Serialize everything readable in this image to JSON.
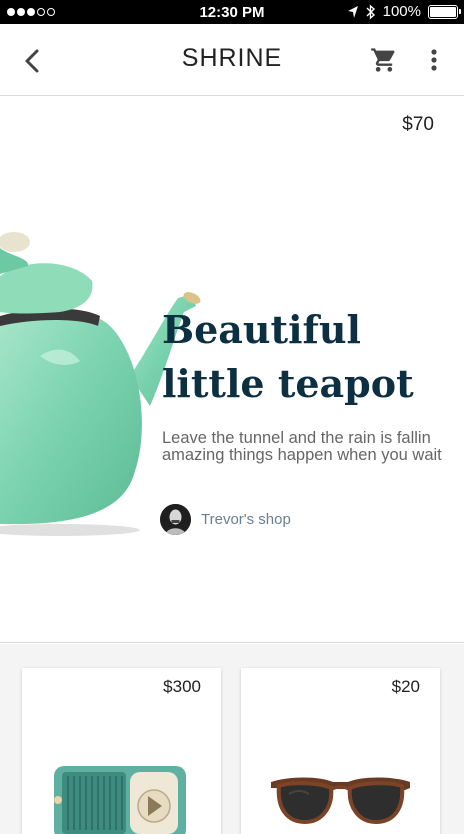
{
  "status_bar": {
    "time": "12:30 PM",
    "battery": "100%"
  },
  "app_bar": {
    "title": "SHRINE"
  },
  "featured": {
    "price": "$70",
    "title_line1": "Beautiful",
    "title_line2": "little teapot",
    "description": "Leave the tunnel and the rain is fallin amazing things happen when you wait",
    "shop": "Trevor's shop"
  },
  "products": [
    {
      "price": "$300"
    },
    {
      "price": "$20"
    }
  ],
  "colors": {
    "title": "#0c2f42",
    "teapot": "#7fd3b0",
    "shop_text": "#6a8090"
  }
}
